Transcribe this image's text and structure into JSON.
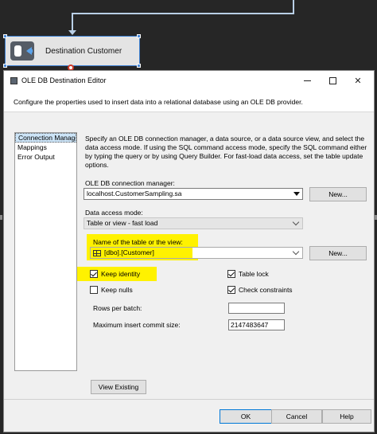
{
  "canvas": {
    "component_label": "Destination Customer"
  },
  "dialog": {
    "title": "OLE DB Destination Editor",
    "header_text": "Configure the properties used to insert data into a relational database using an OLE DB provider.",
    "nav": {
      "items": [
        {
          "label": "Connection Manager",
          "selected": true
        },
        {
          "label": "Mappings",
          "selected": false
        },
        {
          "label": "Error Output",
          "selected": false
        }
      ]
    },
    "description": "Specify an OLE DB connection manager, a data source, or a data source view, and select the data access mode. If using the SQL command access mode, specify the SQL command either by typing the query or by using Query Builder. For fast-load data access, set the table update options.",
    "connection_manager": {
      "label": "OLE DB connection manager:",
      "value": "localhost.CustomerSampling.sa",
      "new_button": "New..."
    },
    "access_mode": {
      "label": "Data access mode:",
      "value": "Table or view - fast load"
    },
    "table": {
      "label": "Name of the table or the view:",
      "value": "[dbo].[Customer]",
      "new_button": "New..."
    },
    "options": {
      "keep_identity": {
        "label": "Keep identity",
        "checked": true
      },
      "keep_nulls": {
        "label": "Keep nulls",
        "checked": false
      },
      "table_lock": {
        "label": "Table lock",
        "checked": true
      },
      "check_constraints": {
        "label": "Check constraints",
        "checked": true
      },
      "rows_per_batch": {
        "label": "Rows per batch:",
        "value": ""
      },
      "max_commit": {
        "label": "Maximum insert commit size:",
        "value": "2147483647"
      }
    },
    "view_existing_button": "View Existing",
    "buttons": {
      "ok": "OK",
      "cancel": "Cancel",
      "help": "Help"
    },
    "highlight_color": "#fff200"
  }
}
